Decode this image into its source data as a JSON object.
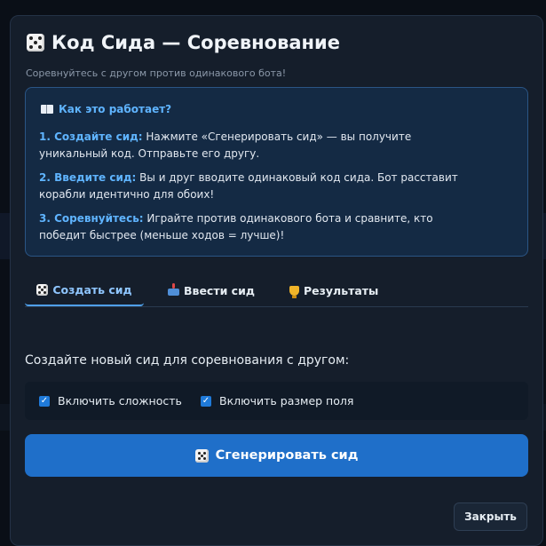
{
  "modal": {
    "title": "Код Сида — Соревнование",
    "subtitle": "Соревнуйтесь с другом против одинакового бота!"
  },
  "info": {
    "heading": "Как это работает?",
    "steps": [
      {
        "label": "1. Создайте сид:",
        "text": " Нажмите «Сгенерировать сид» — вы получите уникальный код. Отправьте его другу."
      },
      {
        "label": "2. Введите сид:",
        "text": " Вы и друг вводите одинаковый код сида. Бот расставит корабли идентично для обоих!"
      },
      {
        "label": "3. Соревнуйтесь:",
        "text": " Играйте против одинакового бота и сравните, кто победит быстрее (меньше ходов = лучше)!"
      }
    ]
  },
  "tabs": [
    {
      "label": "Создать сид",
      "icon": "dice-icon",
      "active": true
    },
    {
      "label": "Ввести сид",
      "icon": "joystick-icon",
      "active": false
    },
    {
      "label": "Результаты",
      "icon": "trophy-icon",
      "active": false
    }
  ],
  "create": {
    "prompt": "Создайте новый сид для соревнования с другом:",
    "options": [
      {
        "label": "Включить сложность",
        "checked": true
      },
      {
        "label": "Включить размер поля",
        "checked": true
      }
    ],
    "generate_label": "Сгенерировать сид"
  },
  "footer": {
    "close_label": "Закрыть"
  },
  "colors": {
    "accent": "#1f6fc9",
    "highlight": "#5fb4ff",
    "modal_bg": "#151e2b",
    "info_bg": "#142a44"
  }
}
